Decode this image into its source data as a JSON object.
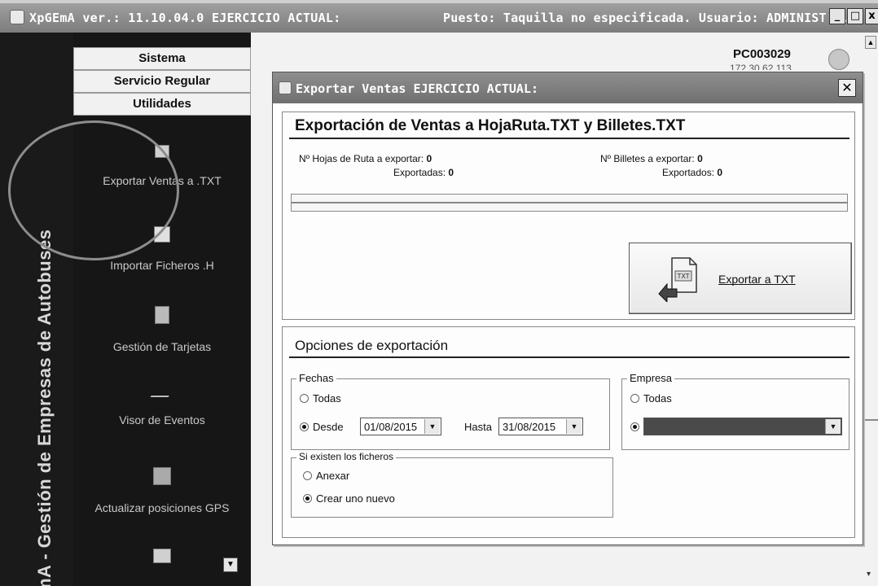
{
  "window": {
    "title_left": "XpGEmA ver.: 11.10.04.0  EJERCICIO ACTUAL:",
    "title_right": "Puesto: Taquilla no especificada. Usuario: ADMINIST...",
    "min_label": "_",
    "max_label": "□",
    "close_label": "x"
  },
  "left_rail": {
    "vertical_text": "mA - Gestión de Empresas de Autobuses"
  },
  "nav": {
    "headers": [
      "Sistema",
      "Servicio Regular",
      "Utilidades"
    ],
    "items": [
      {
        "label": "Exportar Ventas a .TXT",
        "icon": "export-file-icon"
      },
      {
        "label": "Importar Ficheros .H",
        "icon": "import-file-icon"
      },
      {
        "label": "Gestión de Tarjetas",
        "icon": "card-icon"
      },
      {
        "label": "Visor de Eventos",
        "icon": "events-icon"
      },
      {
        "label": "Actualizar posiciones GPS",
        "icon": "gps-icon"
      }
    ],
    "more_arrow": "▼"
  },
  "status": {
    "pc_name": "PC003029",
    "ip": "172.30.62.113"
  },
  "dialog": {
    "title": "Exportar Ventas    EJERCICIO ACTUAL:",
    "close_label": "✕",
    "section_title": "Exportación de Ventas a HojaRuta.TXT y Billetes.TXT",
    "hojas_label": "Nº Hojas de Ruta a exportar:",
    "hojas_value": "0",
    "exportadas_label": "Exportadas:",
    "exportadas_value": "0",
    "billetes_label": "Nº Billetes a exportar:",
    "billetes_value": "0",
    "exportados_label": "Exportados:",
    "exportados_value": "0",
    "progress_hojas": 0,
    "progress_billetes": 0,
    "export_button": "Exportar a TXT",
    "export_icon_text": "TXT",
    "options_title": "Opciones de exportación",
    "fechas": {
      "label": "Fechas",
      "todas": "Todas",
      "desde": "Desde",
      "desde_value": "01/08/2015",
      "hasta": "Hasta",
      "hasta_value": "31/08/2015",
      "selected": "desde"
    },
    "empresa": {
      "label": "Empresa",
      "todas": "Todas",
      "selected": "select"
    },
    "ficheros": {
      "label": "Si existen los ficheros",
      "anexar": "Anexar",
      "crear": "Crear uno nuevo",
      "selected": "crear"
    }
  },
  "colors": {
    "sidebar_bg": "#161616",
    "titlebar_bg": "#7d7d7d",
    "dialog_bg": "#ffffff"
  }
}
